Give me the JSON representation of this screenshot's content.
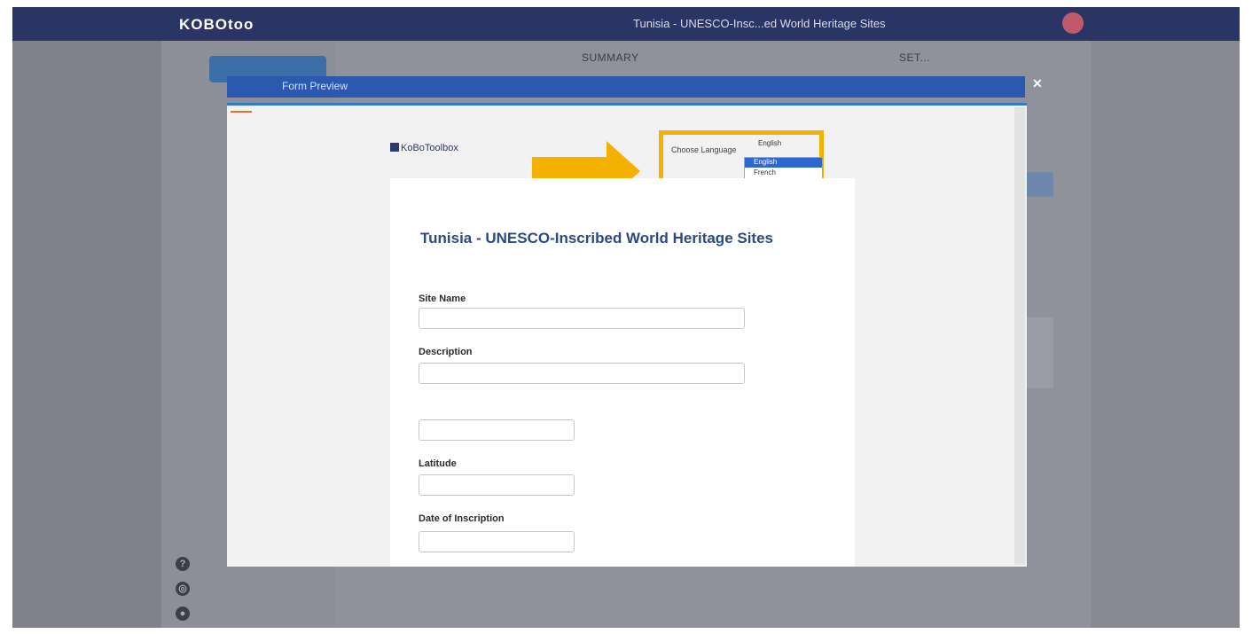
{
  "app": {
    "logo": "KOBOtoo",
    "project_title": "Tunisia - UNESCO-Insc...ed World Heritage Sites"
  },
  "subnav": {
    "summary": "SUMMARY",
    "settings": "SET..."
  },
  "sidebar_footer_icons": [
    "help-icon",
    "support-icon",
    "github-icon"
  ],
  "modal": {
    "title": "Form Preview",
    "close_glyph": "✕",
    "brand": "KoBoToolbox",
    "language": {
      "label": "Choose Language",
      "selected": "English",
      "options": [
        "English",
        "French"
      ]
    },
    "form": {
      "title": "Tunisia - UNESCO-Inscribed World Heritage Sites",
      "questions": [
        {
          "label": "Site Name"
        },
        {
          "label": "Description"
        },
        {
          "label": ""
        },
        {
          "label": "Latitude"
        },
        {
          "label": "Date of Inscription"
        }
      ]
    }
  },
  "colors": {
    "topbar": "#2a3566",
    "modal_header": "#2c59b0",
    "highlight": "#f5b100",
    "primary_button": "#3e6ea8"
  }
}
